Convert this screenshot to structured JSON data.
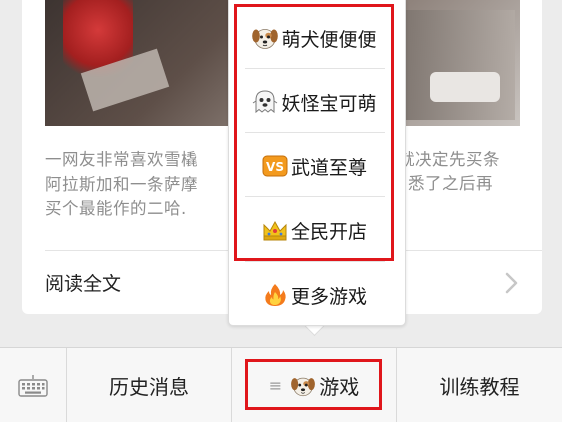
{
  "article": {
    "excerpt_lines": [
      "一网友非常喜欢雪橇",
      "阿拉斯加和一条萨摩",
      "买个最能作的二哈."
    ],
    "excerpt_right_fragments": [
      "就决定先买条",
      "悉了之后再"
    ],
    "read_all_label": "阅读全文"
  },
  "game_menu": {
    "items": [
      {
        "label": "萌犬便便便",
        "icon": "dog-face-icon"
      },
      {
        "label": "妖怪宝可萌",
        "icon": "ghost-icon"
      },
      {
        "label": "武道至尊",
        "icon": "vs-badge-icon"
      },
      {
        "label": "全民开店",
        "icon": "crown-icon"
      },
      {
        "label": "更多游戏",
        "icon": "fire-icon"
      }
    ]
  },
  "bottom_bar": {
    "tabs": [
      {
        "label": "历史消息"
      },
      {
        "label": "游戏",
        "icon": "dog-face-icon"
      },
      {
        "label": "训练教程"
      }
    ]
  },
  "colors": {
    "highlight_red": "#e0161b",
    "vs_badge_orange": "#f39a1e",
    "crown_gold": "#f2c21b"
  }
}
